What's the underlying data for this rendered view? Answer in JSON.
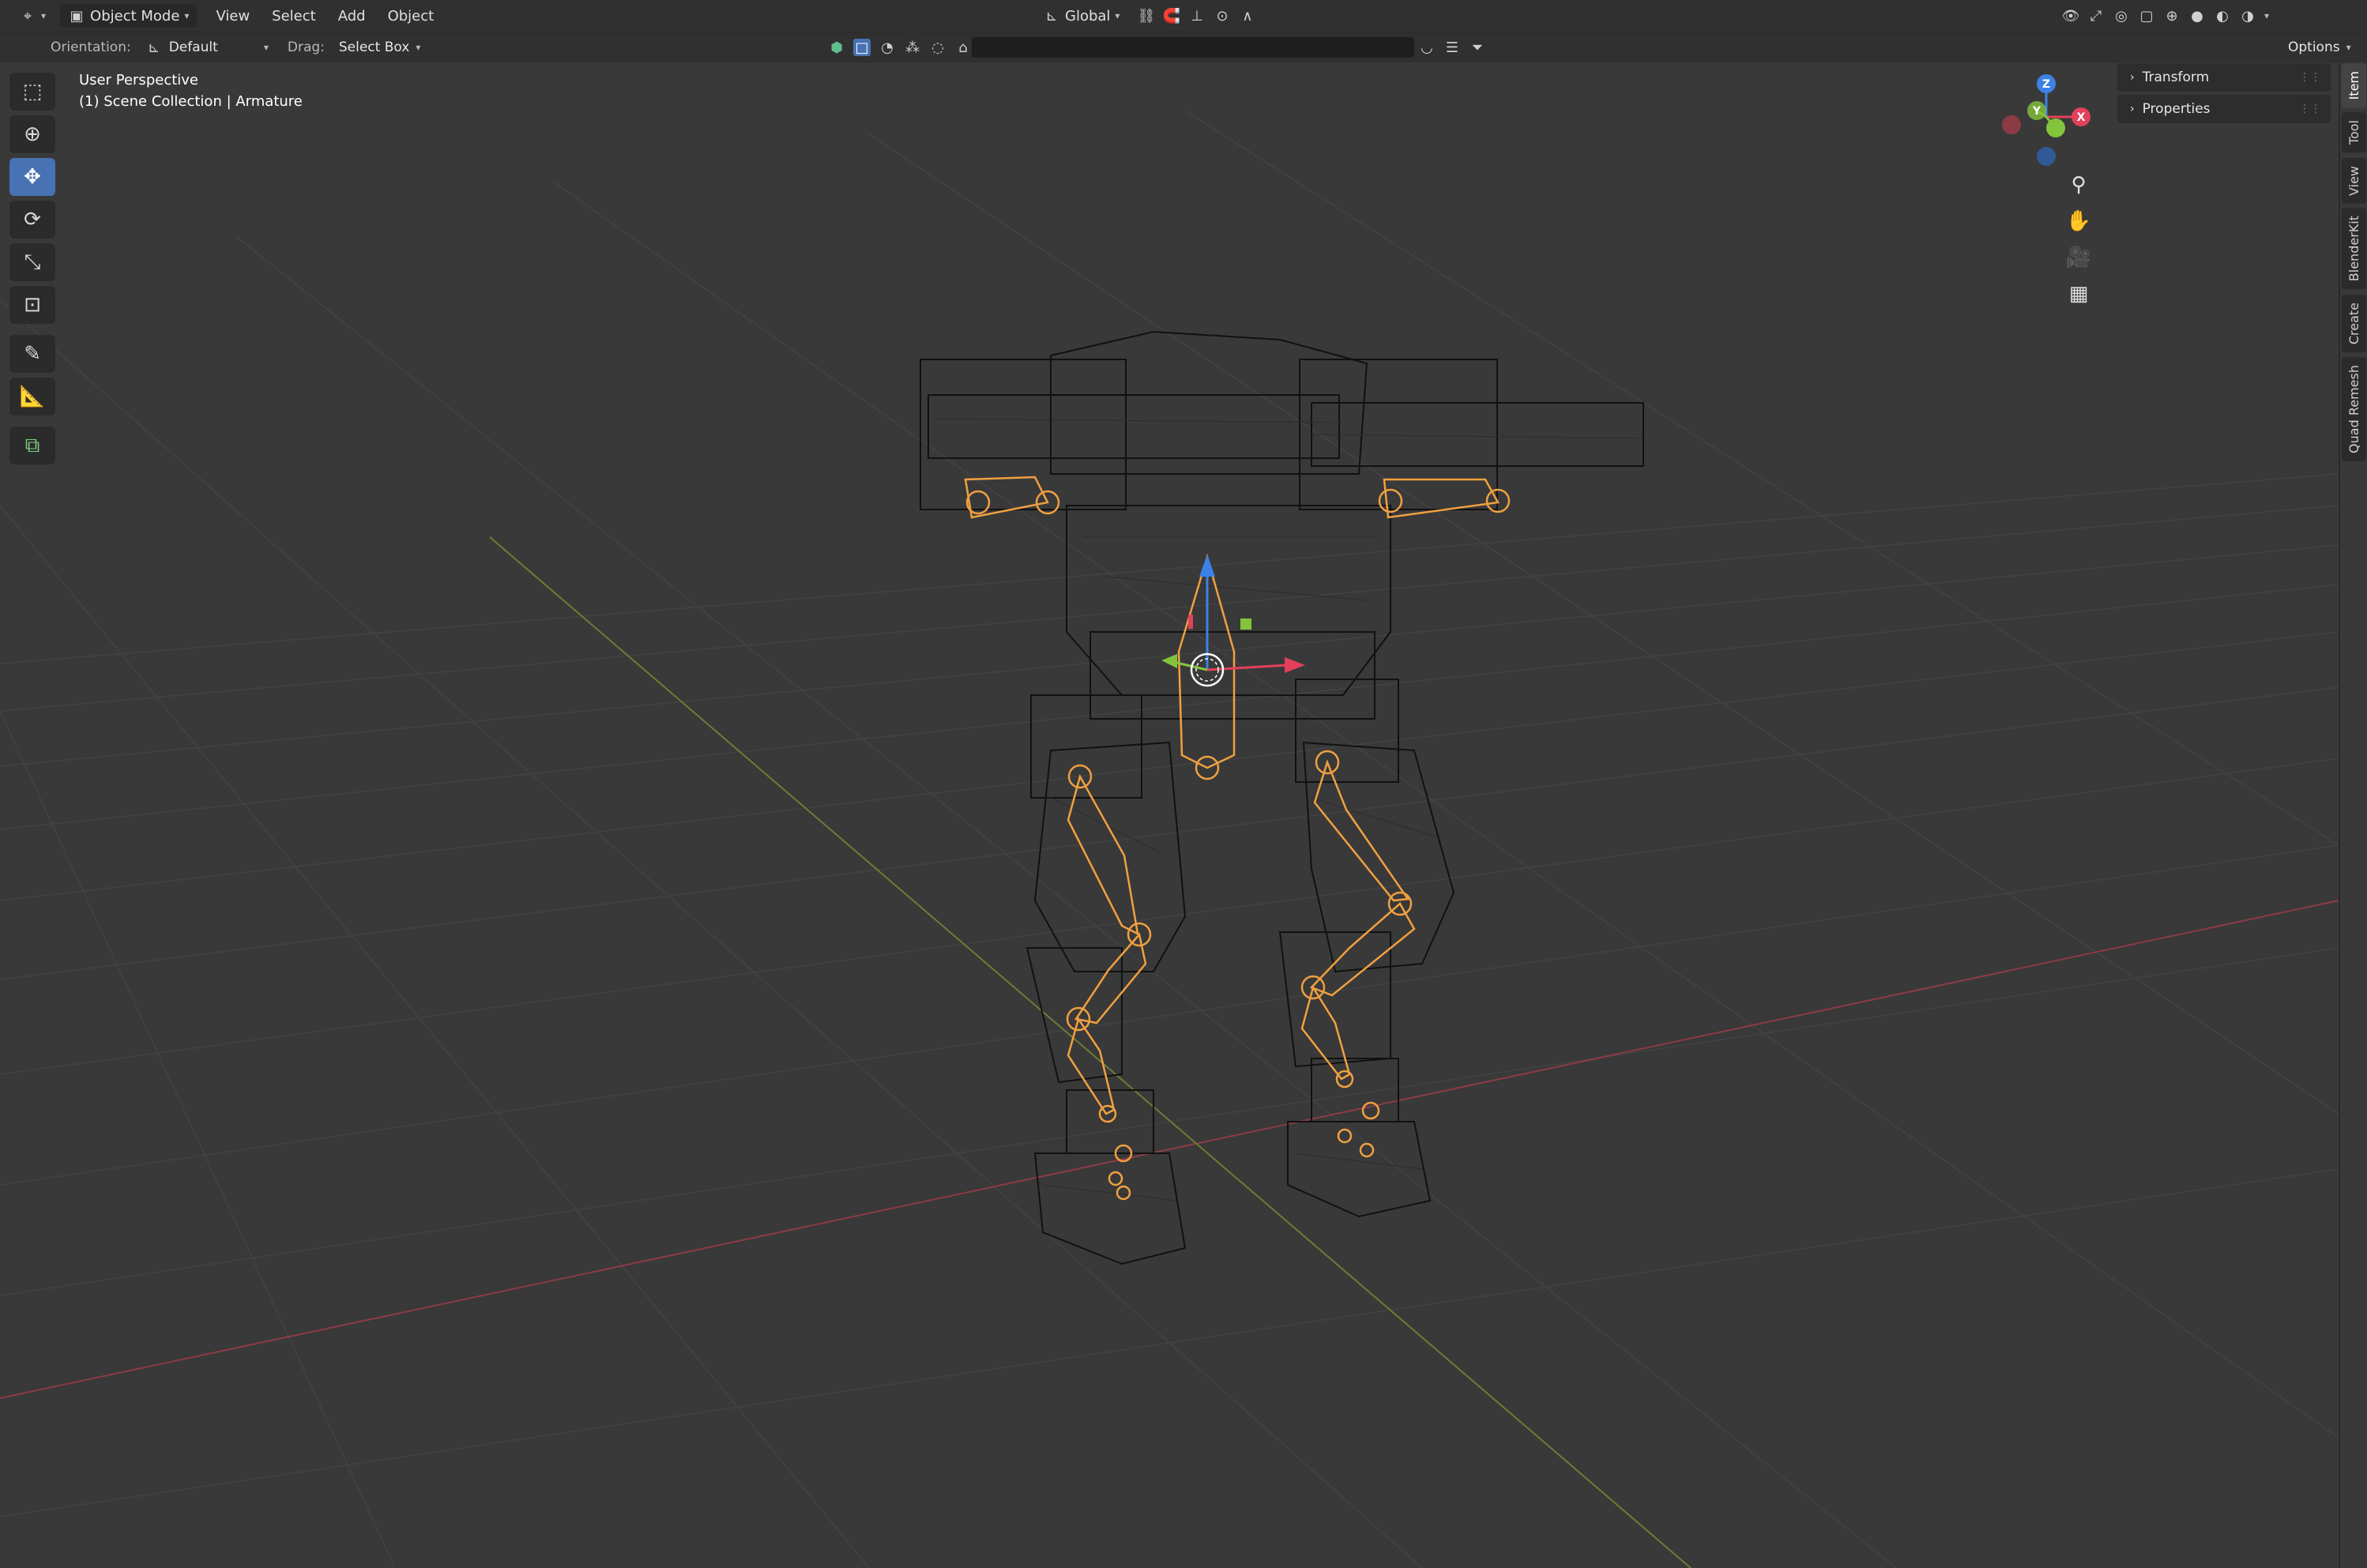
{
  "header": {
    "mode_label": "Object Mode",
    "menus": [
      "View",
      "Select",
      "Add",
      "Object"
    ],
    "transform_orientation": "Global",
    "options_label": "Options"
  },
  "tool_header": {
    "orientation_label": "Orientation:",
    "orientation_value": "Default",
    "drag_label": "Drag:",
    "drag_value": "Select Box"
  },
  "viewport": {
    "view_name": "User Perspective",
    "collection_info": "(1) Scene Collection | Armature",
    "gizmo_axes": [
      "Z",
      "Y",
      "X"
    ],
    "axis_colors": {
      "x": "#e4405b",
      "y": "#84c43c",
      "z": "#3c82e6"
    }
  },
  "toolbar": {
    "tools": [
      "select-box",
      "cursor",
      "move",
      "rotate",
      "scale",
      "transform",
      "annotate",
      "measure",
      "add-cube"
    ],
    "active_tool": "move"
  },
  "npanel": {
    "sections": [
      "Transform",
      "Properties"
    ],
    "tabs": [
      "Item",
      "Tool",
      "View",
      "BlenderKit",
      "Create",
      "Quad Remesh"
    ]
  },
  "colors": {
    "accent": "#4772b3",
    "bone_orange": "#f0a040"
  }
}
